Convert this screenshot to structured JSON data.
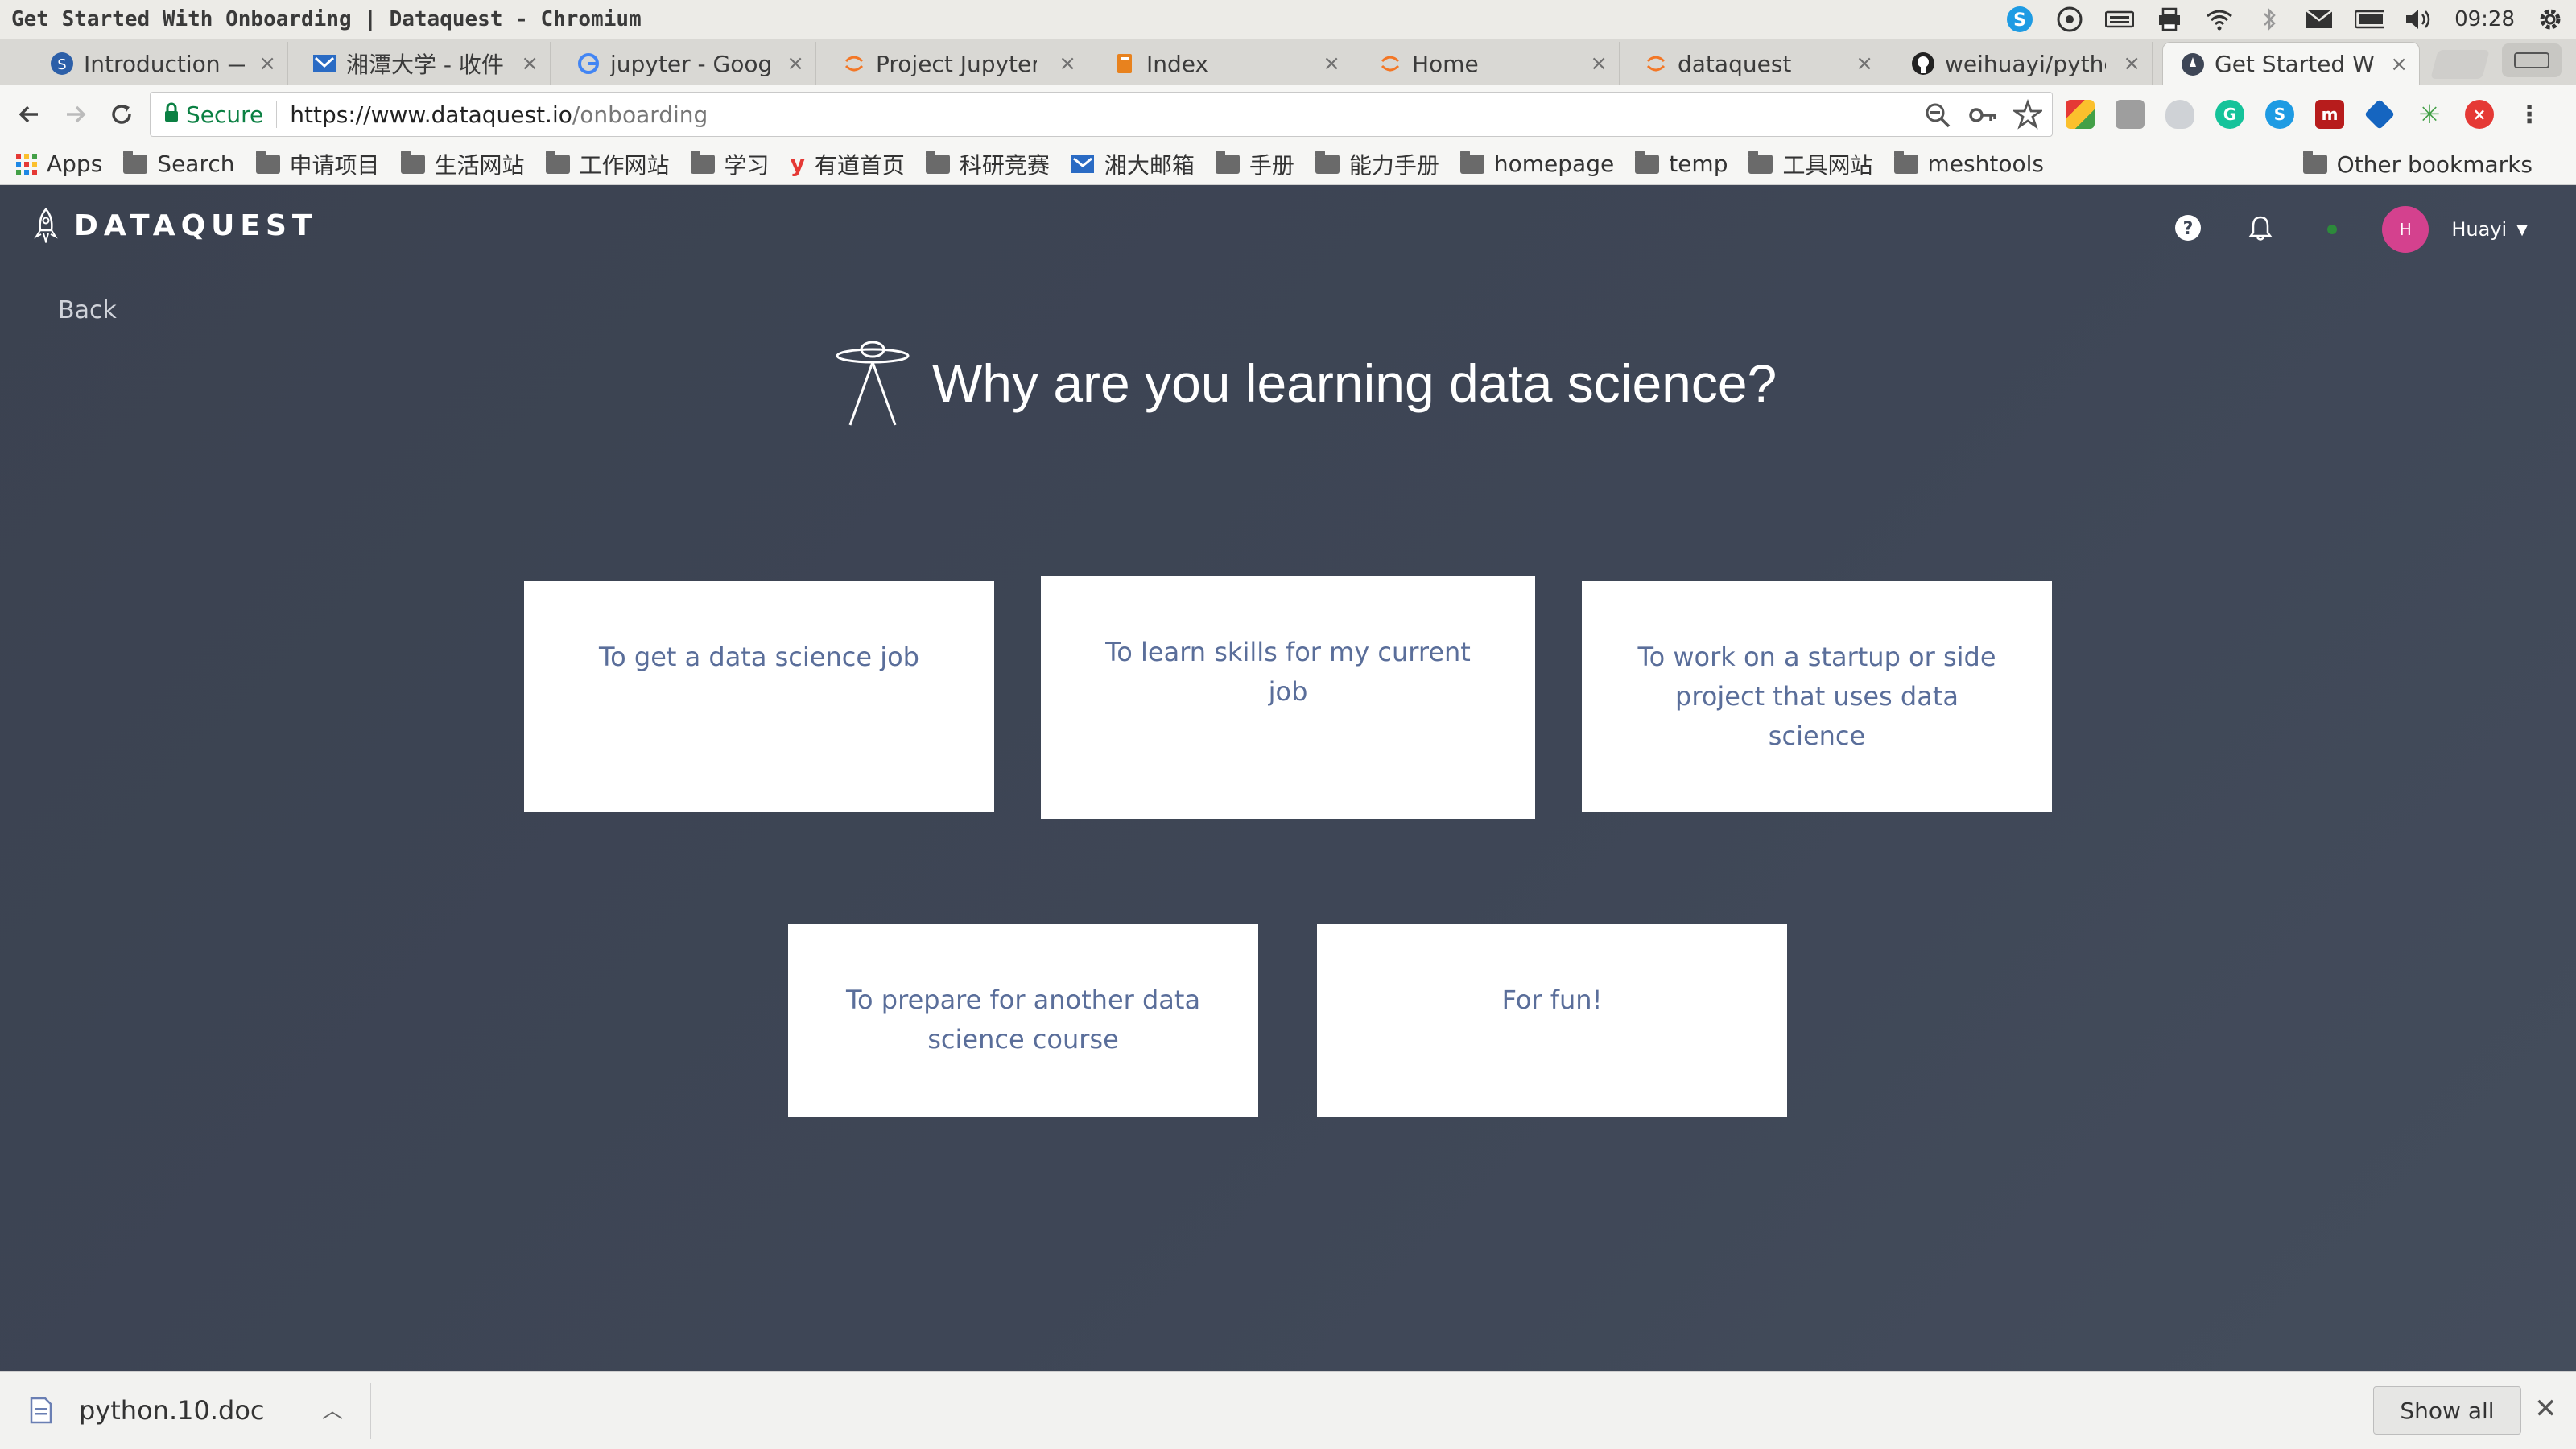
{
  "os": {
    "window_title": "Get Started With Onboarding | Dataquest - Chromium",
    "clock": "09:28",
    "tray_icons": [
      "skype-icon",
      "chrome-sync-icon",
      "keyboard-icon",
      "printer-icon",
      "wifi-icon",
      "bluetooth-icon",
      "mail-icon",
      "battery-icon",
      "volume-icon",
      "settings-gear-icon"
    ]
  },
  "tabs": [
    {
      "title": "Introduction —",
      "favicon": "dataquest-favicon"
    },
    {
      "title": "湘潭大学 - 收件",
      "favicon": "xtu-mail-favicon"
    },
    {
      "title": "jupyter - Googl",
      "favicon": "google-favicon"
    },
    {
      "title": "Project Jupyter",
      "favicon": "jupyter-favicon"
    },
    {
      "title": "Index",
      "favicon": "book-favicon"
    },
    {
      "title": "Home",
      "favicon": "jupyter-favicon"
    },
    {
      "title": "dataquest",
      "favicon": "jupyter-favicon"
    },
    {
      "title": "weihuayi/pytho",
      "favicon": "github-favicon"
    },
    {
      "title": "Get Started Wi",
      "favicon": "dataquest-favicon",
      "active": true
    }
  ],
  "toolbar": {
    "secure_label": "Secure",
    "url_host": "https://www.dataquest.io",
    "url_path": "/onboarding"
  },
  "bookmarks": {
    "apps_label": "Apps",
    "items": [
      "Search",
      "申请项目",
      "生活网站",
      "工作网站",
      "学习",
      "有道首页",
      "科研竞赛",
      "湘大邮箱",
      "手册",
      "能力手册",
      "homepage",
      "temp",
      "工具网站",
      "meshtools"
    ],
    "other_label": "Other bookmarks"
  },
  "header": {
    "brand": "DATAQUEST",
    "avatar_initial": "H",
    "user_name": "Huayi"
  },
  "page": {
    "back_label": "Back",
    "question": "Why are you learning data science?",
    "options": [
      "To get a data science job",
      "To learn skills for my current job",
      "To work on a startup or side project that uses data science",
      "To prepare for another data science course",
      "For fun!"
    ]
  },
  "downloads": {
    "file_name": "python.10.doc",
    "show_all_label": "Show all"
  },
  "colors": {
    "page_bg": "#3e4656",
    "option_text": "#5a6e9a",
    "avatar": "#d4418e",
    "secure": "#0b8043"
  }
}
